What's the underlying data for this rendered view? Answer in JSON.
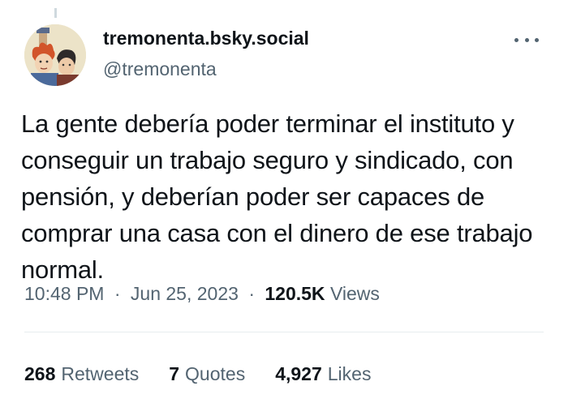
{
  "tweet": {
    "display_name": "tremonenta.bsky.social",
    "handle": "@tremonenta",
    "text": "La gente debería poder terminar el instituto y conseguir un trabajo seguro y sindicado, con pensión, y deberían poder ser capaces de comprar una casa con el dinero de ese trabajo normal.",
    "time": "10:48 PM",
    "date": "Jun 25, 2023",
    "separator": "·",
    "views_count": "120.5K",
    "views_label": "Views"
  },
  "stats": {
    "retweets_count": "268",
    "retweets_label": "Retweets",
    "quotes_count": "7",
    "quotes_label": "Quotes",
    "likes_count": "4,927",
    "likes_label": "Likes"
  },
  "icons": {
    "more": "more-horizontal-icon",
    "avatar": "medieval-illustration-avatar"
  },
  "colors": {
    "text_primary": "#0f1419",
    "text_secondary": "#536471",
    "divider": "#e7ecef"
  }
}
